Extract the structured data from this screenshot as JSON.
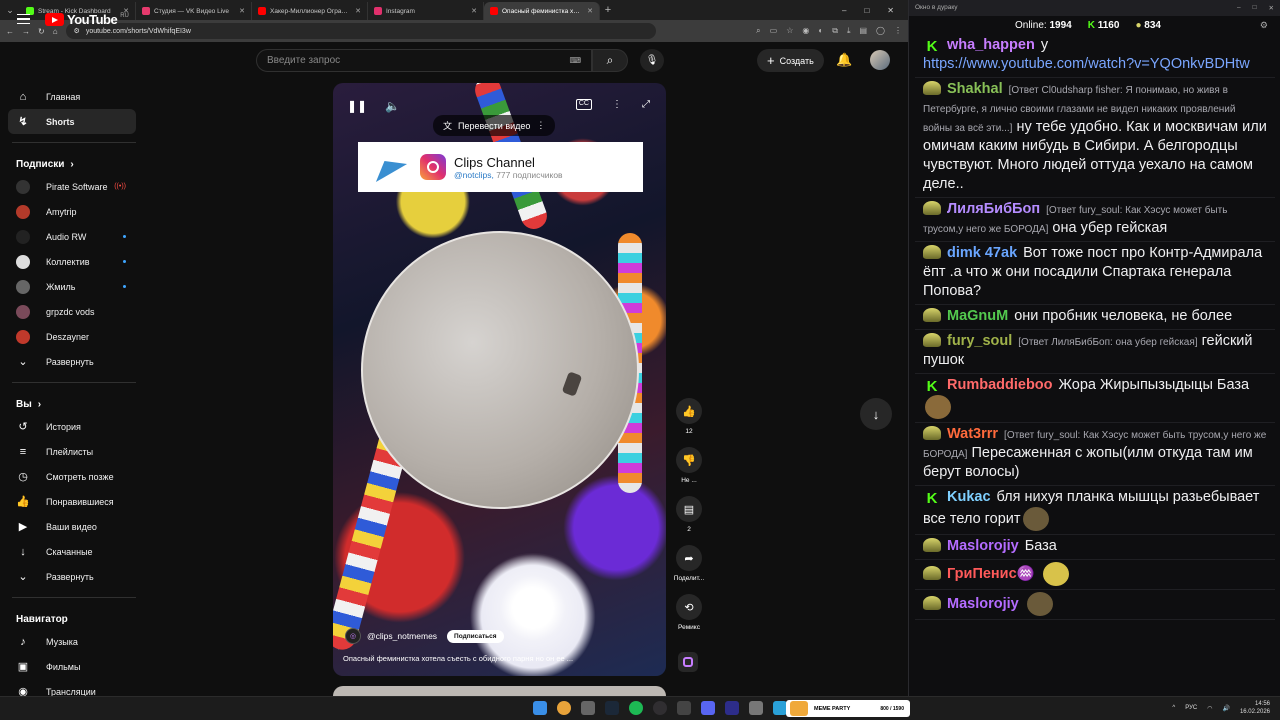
{
  "browser": {
    "tabs": [
      {
        "title": "Stream - Kick Dashboard",
        "color": "#53fc18"
      },
      {
        "title": "Студия — VK Видео Live",
        "color": "#e63a6d"
      },
      {
        "title": "Хакер-Миллионер Ограбил Г...",
        "color": "#ff0000"
      },
      {
        "title": "Instagram",
        "color": "#e1306c"
      },
      {
        "title": "Опасный феминистка хотел...",
        "color": "#ff0000"
      }
    ],
    "url": "youtube.com/shorts/VdWhifqEI3w"
  },
  "youtube": {
    "logo_text": "YouTube",
    "logo_region": "RU",
    "search_placeholder": "Введите запрос",
    "create_label": "Создать"
  },
  "sidebar": {
    "main": [
      {
        "label": "Главная",
        "icon": "home-icon",
        "glyph": "⌂"
      },
      {
        "label": "Shorts",
        "icon": "shorts-icon",
        "glyph": "↯"
      }
    ],
    "subs_title": "Подписки",
    "subs": [
      {
        "label": "Pirate Software",
        "color": "#333",
        "status": "live"
      },
      {
        "label": "Amytrip",
        "color": "#b33a2a",
        "status": ""
      },
      {
        "label": "Audio RW",
        "color": "#222",
        "status": "dot"
      },
      {
        "label": "Коллектив",
        "color": "#ddd",
        "status": "dot"
      },
      {
        "label": "Жмиль",
        "color": "#666",
        "status": "dot"
      },
      {
        "label": "grpzdc vods",
        "color": "#7a4a5a",
        "status": ""
      },
      {
        "label": "Deszayner",
        "color": "#c0392b",
        "status": ""
      }
    ],
    "expand1": "Развернуть",
    "you_title": "Вы",
    "you": [
      {
        "label": "История",
        "glyph": "↺"
      },
      {
        "label": "Плейлисты",
        "glyph": "≡"
      },
      {
        "label": "Смотреть позже",
        "glyph": "◷"
      },
      {
        "label": "Понравившиеся",
        "glyph": "👍"
      },
      {
        "label": "Ваши видео",
        "glyph": "▶"
      },
      {
        "label": "Скачанные",
        "glyph": "↓"
      }
    ],
    "expand2": "Развернуть",
    "nav_title": "Навигатор",
    "nav": [
      {
        "label": "Музыка",
        "glyph": "♪"
      },
      {
        "label": "Фильмы",
        "glyph": "▣"
      },
      {
        "label": "Трансляции",
        "glyph": "◉"
      }
    ]
  },
  "video": {
    "translate_label": "Перевести видео",
    "card_title": "Clips Channel",
    "card_handle": "@notclips",
    "card_subs": "777 подписчиков",
    "channel": "@clips_notmemes",
    "subscribe_label": "Подписаться",
    "title": "Опасный феминистка хотела съесть с обидного парня но он ее ..."
  },
  "actions": {
    "likes": "12",
    "dislike_label": "Не ...",
    "comments": "2",
    "share_label": "Поделит...",
    "remix_label": "Ремикс"
  },
  "chat": {
    "window_title": "Окно в дураку",
    "online_label": "Online:",
    "online": "1994",
    "kick_count": "1160",
    "viewer_count": "834",
    "messages": [
      {
        "badge": "k",
        "user": "wha_happen",
        "color": "#c77dff",
        "reply": "",
        "text": "у",
        "link": "https://www.youtube.com/watch?v=YQOnkvBDHtw"
      },
      {
        "badge": "p",
        "user": "Shakhal",
        "color": "#88c057",
        "reply": "[Ответ Cl0udsharp fisher: Я понимаю, но живя в Петербурге, я лично своими глазами не видел никаких проявлений войны за всё эти...]",
        "text": "ну тебе удобно. Как и москвичам или омичам каким нибудь в Сибири. А белгородцы чувствуют. Много людей оттуда уехало на самом деле..",
        "link": ""
      },
      {
        "badge": "p",
        "user": "ЛиляБибБоп",
        "color": "#b58cff",
        "reply": "[Ответ fury_soul: Как Хэсус может быть трусом,у него же БОРОДА]",
        "text": "она убер гейская",
        "link": ""
      },
      {
        "badge": "p",
        "user": "dimk 47ak",
        "color": "#6aa6ff",
        "reply": "",
        "text": "Вот тоже пост про Контр-Адмирала ёпт .а что ж они посадили Спартака  генерала Попова?",
        "link": ""
      },
      {
        "badge": "p",
        "user": "MaGnuM",
        "color": "#53c94e",
        "reply": "",
        "text": "они пробник человека, не более",
        "link": ""
      },
      {
        "badge": "p",
        "user": "fury_soul",
        "color": "#a0b24a",
        "reply": "[Ответ ЛиляБибБоп: она убер гейская]",
        "text": "гейский пушок",
        "link": ""
      },
      {
        "badge": "k",
        "user": "Rumbaddieboo",
        "color": "#ff6a6a",
        "reply": "",
        "text": "Жора Жирыпызыдыцы База",
        "link": ""
      },
      {
        "badge": "p",
        "user": "Wat3rrr",
        "color": "#ff6a3c",
        "reply": "[Ответ fury_soul: Как Хэсус может быть трусом,у него же БОРОДА]",
        "text": "Пересаженная с жопы(илм откуда там им берут волосы)",
        "link": ""
      },
      {
        "badge": "k",
        "user": "Kukac",
        "color": "#7fd0ff",
        "reply": "",
        "text": "бля нихуя планка мышцы разьебывает все тело горит",
        "link": ""
      },
      {
        "badge": "p",
        "user": "Maslorojiy",
        "color": "#b46cff",
        "reply": "",
        "text": "База",
        "link": ""
      },
      {
        "badge": "p",
        "user": "ГриПенис♒",
        "color": "#ff5a5a",
        "reply": "",
        "text": "",
        "link": ""
      },
      {
        "badge": "p",
        "user": "Maslorojiy",
        "color": "#b46cff",
        "reply": "",
        "text": "",
        "link": ""
      }
    ]
  },
  "taskbar": {
    "meme_label": "MEME PARTY",
    "meme_count": "800 / 1590",
    "lang": "РУС",
    "time": "14:56",
    "date": "16.02.2026"
  }
}
